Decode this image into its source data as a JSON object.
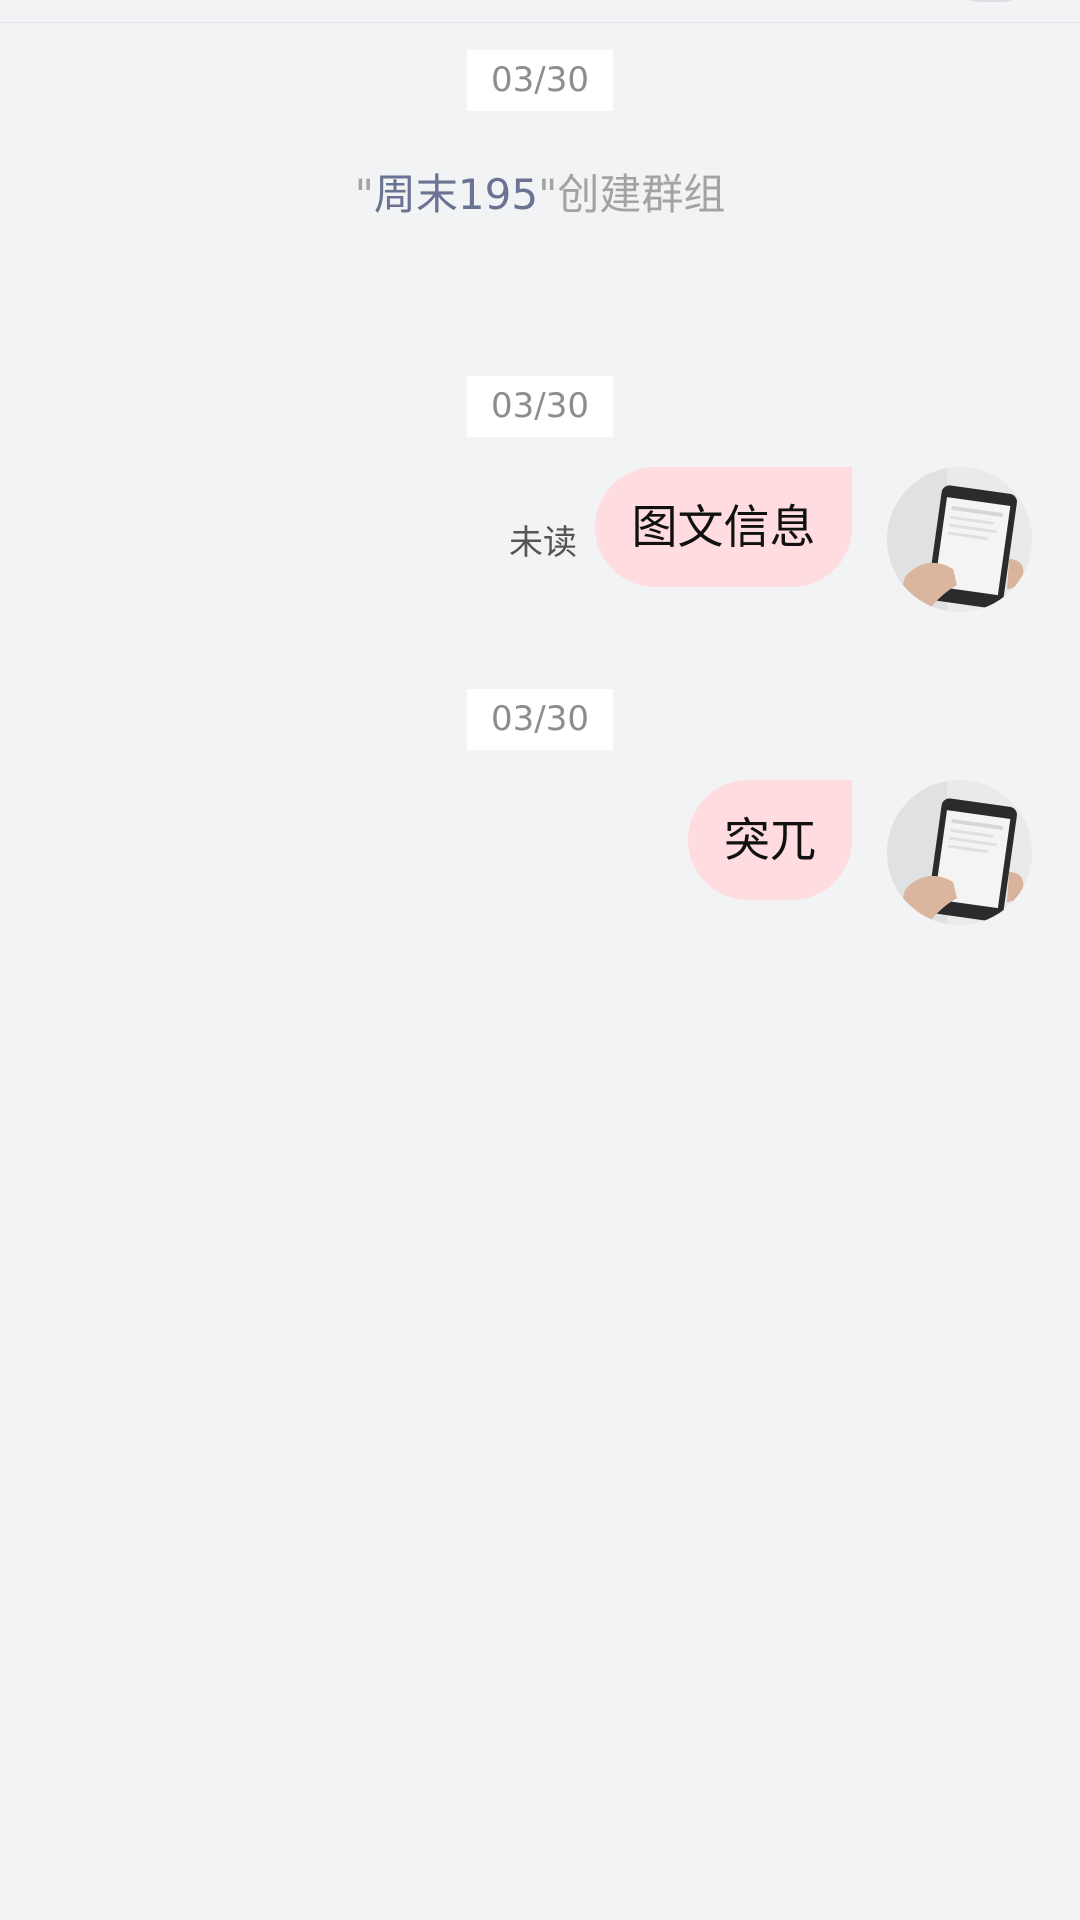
{
  "chat": {
    "date_1": "03/30",
    "system_message": {
      "open_quote": "\"",
      "name": "周末195",
      "close_quote": "\"",
      "action": "创建群组"
    },
    "messages": [
      {
        "date": "03/30",
        "text": "图文信息",
        "status": "未读",
        "avatar": "phone-in-hand-photo"
      },
      {
        "date": "03/30",
        "text": "突兀",
        "avatar": "phone-in-hand-photo"
      }
    ]
  },
  "colors": {
    "background": "#f2f3f5",
    "bubble": "#fedcdf",
    "name_link": "#6a7393",
    "system_text": "#a3a3a3"
  }
}
